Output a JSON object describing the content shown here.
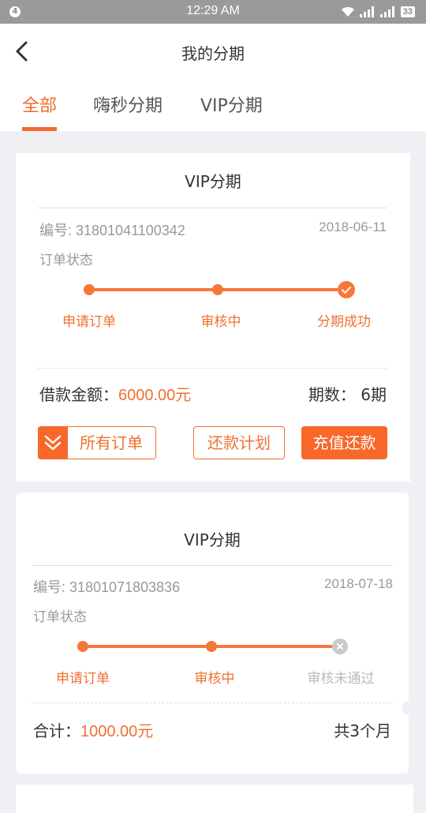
{
  "status_bar": {
    "notification_count": "4",
    "time": "12:29 AM",
    "battery": "33"
  },
  "nav": {
    "title": "我的分期"
  },
  "tabs": [
    {
      "label": "全部"
    },
    {
      "label": "嗨秒分期"
    },
    {
      "label": "VIP分期"
    }
  ],
  "cards": [
    {
      "title": "VIP分期",
      "order_no": "编号: 31801041100342",
      "date": "2018-06-11",
      "status_label": "订单状态",
      "steps": [
        "申请订单",
        "审核中",
        "分期成功"
      ],
      "amount_label": "借款金额：",
      "amount_value": "6000.00元",
      "period_label": "期数：",
      "period_value": "6期",
      "buttons": {
        "all_orders": "所有订单",
        "repay_plan": "还款计划",
        "recharge_repay": "充值还款"
      }
    },
    {
      "title": "VIP分期",
      "order_no": "编号: 31801071803836",
      "date": "2018-07-18",
      "status_label": "订单状态",
      "steps": [
        "申请订单",
        "审核中",
        "审核未通过"
      ],
      "total_label": "合计：",
      "total_value": "1000.00元",
      "months": "共3个月"
    }
  ],
  "colors": {
    "accent": "#f7773a",
    "status_bar": "#9a9a9a",
    "background": "#efeff4"
  }
}
